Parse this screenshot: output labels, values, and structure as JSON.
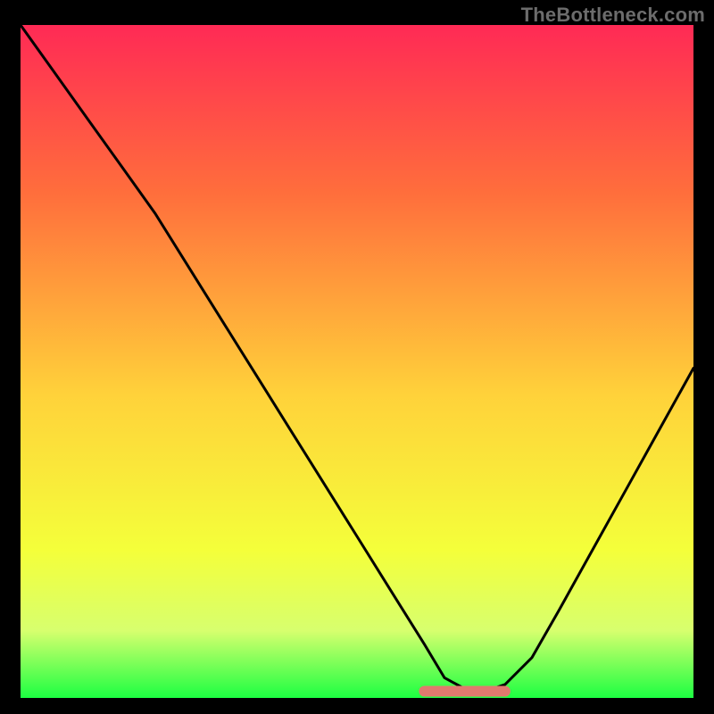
{
  "watermark": "TheBottleneck.com",
  "colors": {
    "gradient_top": "#ff2a55",
    "gradient_mid_upper": "#ff6e3c",
    "gradient_mid": "#ffd23a",
    "gradient_mid_lower": "#f4ff3a",
    "gradient_lower": "#d7ff6e",
    "gradient_bottom": "#1cff42",
    "curve": "#000000",
    "highlight": "#e07a6e",
    "frame": "#000000"
  },
  "chart_data": {
    "type": "line",
    "title": "",
    "xlabel": "",
    "ylabel": "",
    "xlim": [
      0,
      100
    ],
    "ylim": [
      0,
      100
    ],
    "grid": false,
    "legend": false,
    "series": [
      {
        "name": "bottleneck-curve",
        "x": [
          0,
          5,
          10,
          15,
          20,
          25,
          30,
          35,
          40,
          45,
          50,
          55,
          60,
          63,
          66.67,
          69,
          72,
          76,
          80,
          85,
          90,
          95,
          100
        ],
        "y": [
          100,
          93,
          86,
          79,
          72,
          64,
          56,
          48,
          40,
          32,
          24,
          16,
          8,
          3,
          1,
          1,
          2,
          6,
          13,
          22,
          31,
          40,
          49
        ]
      }
    ],
    "annotations": [
      {
        "name": "minimum-highlight",
        "type": "segment",
        "x_start": 60,
        "x_end": 72,
        "y": 1,
        "note": "thick red highlight at curve minimum"
      }
    ]
  }
}
